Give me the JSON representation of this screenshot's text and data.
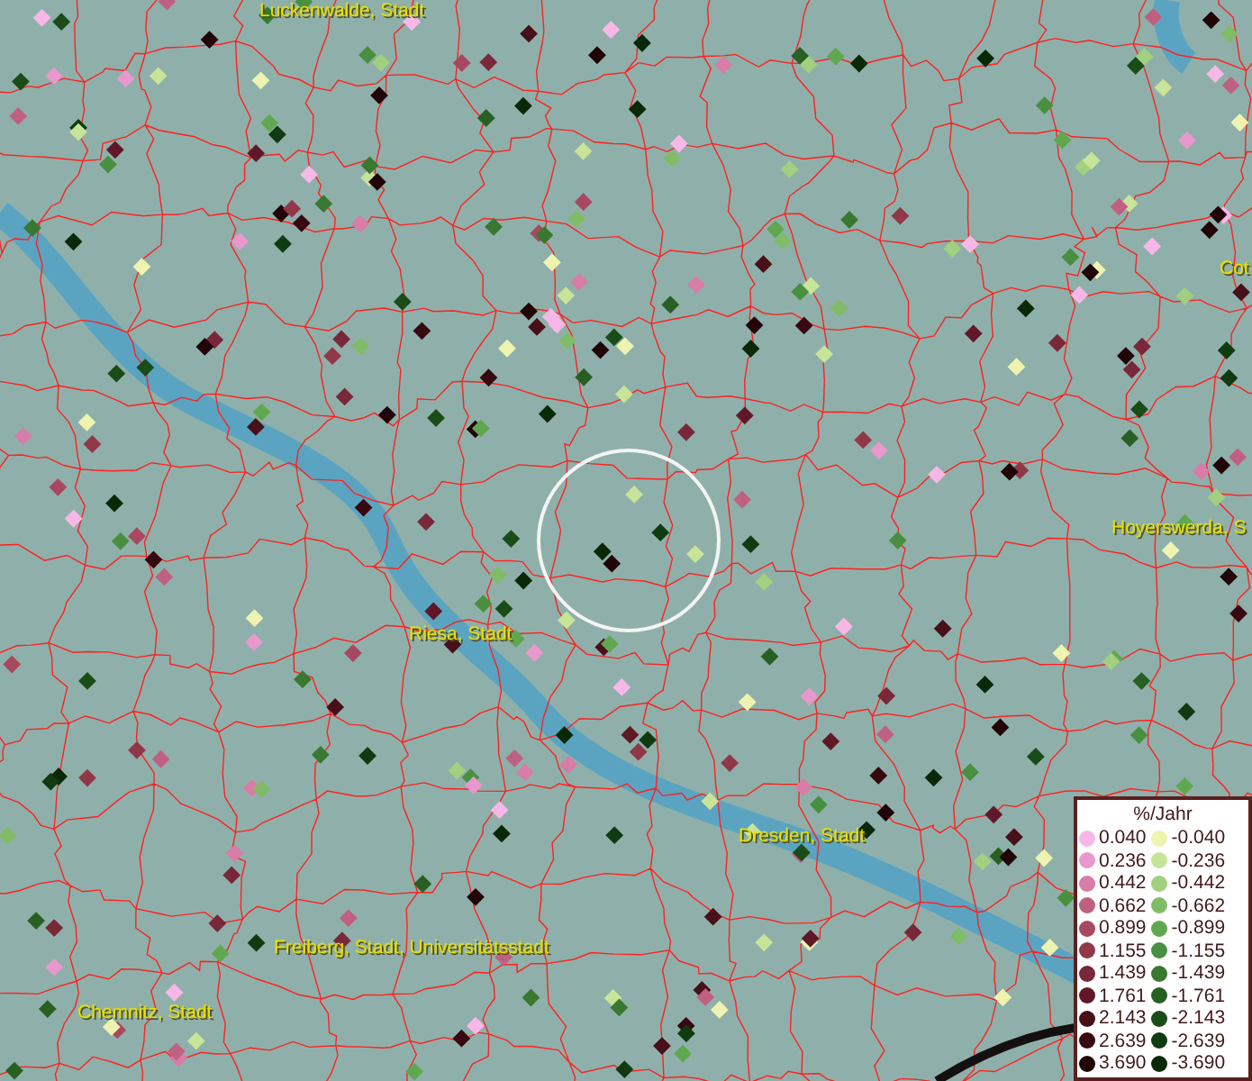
{
  "map": {
    "places": [
      {
        "name": "Luckenwalde, Stadt"
      },
      {
        "name": "Cot"
      },
      {
        "name": "Hoyerswerda, S"
      },
      {
        "name": "Riesa, Stadt"
      },
      {
        "name": "Dresden, Stadt"
      },
      {
        "name": "Freiberg, Stadt, Universitätsstadt"
      },
      {
        "name": "Chemnitz, Stadt"
      }
    ]
  },
  "legend": {
    "title": "%/Jahr",
    "columns": [
      [
        {
          "label": "0.040",
          "color": "#f7b8e8"
        },
        {
          "label": "0.236",
          "color": "#e898cc"
        },
        {
          "label": "0.442",
          "color": "#d87ca8"
        },
        {
          "label": "0.662",
          "color": "#c06080"
        },
        {
          "label": "0.899",
          "color": "#a84860"
        },
        {
          "label": "1.155",
          "color": "#903848"
        },
        {
          "label": "1.439",
          "color": "#782838"
        },
        {
          "label": "1.761",
          "color": "#601828"
        },
        {
          "label": "2.143",
          "color": "#481018"
        },
        {
          "label": "2.639",
          "color": "#380810"
        },
        {
          "label": "3.690",
          "color": "#200408"
        }
      ],
      [
        {
          "label": "-0.040",
          "color": "#eef4b0"
        },
        {
          "label": "-0.236",
          "color": "#c8e498"
        },
        {
          "label": "-0.442",
          "color": "#a0d080"
        },
        {
          "label": "-0.662",
          "color": "#80bc68"
        },
        {
          "label": "-0.899",
          "color": "#60a850"
        },
        {
          "label": "-1.155",
          "color": "#489040"
        },
        {
          "label": "-1.439",
          "color": "#387830"
        },
        {
          "label": "-1.761",
          "color": "#286024"
        },
        {
          "label": "-2.143",
          "color": "#1a4c18"
        },
        {
          "label": "-2.639",
          "color": "#103a10"
        },
        {
          "label": "-3.690",
          "color": "#082808"
        }
      ]
    ]
  }
}
